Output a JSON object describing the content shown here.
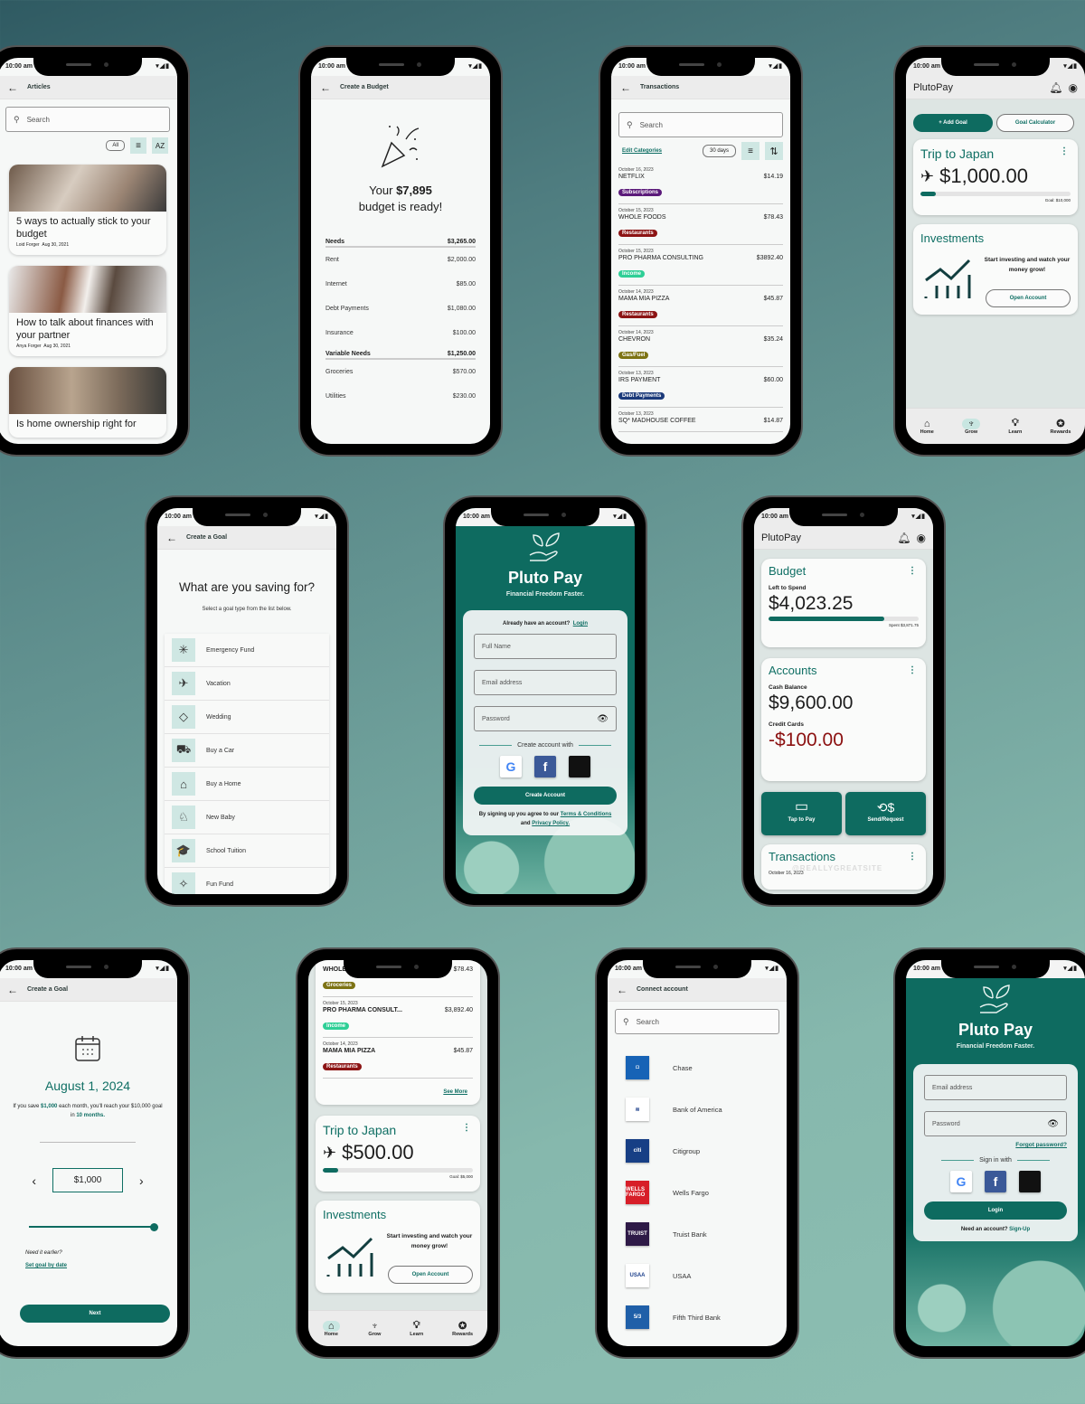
{
  "status_time": "10:00 am",
  "status_icons": "▾◢▮",
  "articles": {
    "title": "Articles",
    "search_placeholder": "Search",
    "filter_all": "All",
    "sort_label": "AZ",
    "items": [
      {
        "title": "5 ways to actually stick to your budget",
        "author": "Loid Forger",
        "date": "Aug 30, 2021"
      },
      {
        "title": "How to talk about finances with your partner",
        "author": "Anya Forger",
        "date": "Aug 30, 2021"
      },
      {
        "title": "Is home ownership right for",
        "author": "",
        "date": ""
      }
    ]
  },
  "budget_ready": {
    "title": "Create a Budget",
    "heading_prefix": "Your",
    "heading_amount": "$7,895",
    "heading_suffix": "budget is ready!",
    "sections": [
      {
        "name": "Needs",
        "total": "$3,265.00",
        "rows": [
          {
            "label": "Rent",
            "value": "$2,000.00"
          },
          {
            "label": "Internet",
            "value": "$85.00"
          },
          {
            "label": "Debt Payments",
            "value": "$1,080.00"
          },
          {
            "label": "Insurance",
            "value": "$100.00"
          }
        ]
      },
      {
        "name": "Variable Needs",
        "total": "$1,250.00",
        "rows": [
          {
            "label": "Groceries",
            "value": "$570.00"
          },
          {
            "label": "Utilities",
            "value": "$230.00"
          }
        ]
      }
    ]
  },
  "transactions": {
    "title": "Transactions",
    "search_placeholder": "Search",
    "edit_categories": "Edit Categories",
    "range": "30 days",
    "items": [
      {
        "date": "October 16, 2023",
        "name": "NETFLIX",
        "amount": "$14.19",
        "category": "Subscriptions",
        "color": "#5b1a7a"
      },
      {
        "date": "October 15, 2023",
        "name": "WHOLE FOODS",
        "amount": "$78.43",
        "category": "Restaurants",
        "color": "#8c1414"
      },
      {
        "date": "October 15, 2023",
        "name": "PRO PHARMA CONSULTING",
        "amount": "$3892.40",
        "category": "Income",
        "color": "#2ecf96"
      },
      {
        "date": "October 14, 2023",
        "name": "MAMA MIA PIZZA",
        "amount": "$45.87",
        "category": "Restaurants",
        "color": "#8c1414"
      },
      {
        "date": "October 14, 2023",
        "name": "CHEVRON",
        "amount": "$35.24",
        "category": "Gas/Fuel",
        "color": "#7d7314"
      },
      {
        "date": "October 13, 2023",
        "name": "IRS PAYMENT",
        "amount": "$60.00",
        "category": "Debt Payments",
        "color": "#1b3a7a"
      },
      {
        "date": "October 13, 2023",
        "name": "SQ* MADHOUSE COFFEE",
        "amount": "$14.87",
        "category": "",
        "color": "#8c1414"
      }
    ]
  },
  "grow": {
    "app_name": "PlutoPay",
    "add_goal": "+ Add Goal",
    "goal_calculator": "Goal Calculator",
    "goal_title": "Trip to Japan",
    "goal_amount": "$1,000.00",
    "goal_target": "Goal: $10,000",
    "goal_progress": 0.1,
    "investments_title": "Investments",
    "investments_text": "Start investing and watch your money grow!",
    "open_account": "Open Account",
    "active_tab": "Grow"
  },
  "tabs": [
    "Home",
    "Grow",
    "Learn",
    "Rewards"
  ],
  "create_goal": {
    "title": "Create a Goal",
    "heading": "What are you saving for?",
    "subheading": "Select a goal type from the list below.",
    "items": [
      {
        "label": "Emergency Fund",
        "icon": "✳"
      },
      {
        "label": "Vacation",
        "icon": "✈"
      },
      {
        "label": "Wedding",
        "icon": "◇"
      },
      {
        "label": "Buy a Car",
        "icon": "⛟"
      },
      {
        "label": "Buy a Home",
        "icon": "⌂"
      },
      {
        "label": "New Baby",
        "icon": "♘"
      },
      {
        "label": "School Tuition",
        "icon": "🎓"
      },
      {
        "label": "Fun Fund",
        "icon": "✧"
      }
    ]
  },
  "signup": {
    "brand": "Pluto Pay",
    "tagline": "Financial Freedom Faster.",
    "have_account": "Already have an account?",
    "login_link": "Login",
    "full_name_placeholder": "Full Name",
    "email_placeholder": "Email address",
    "password_placeholder": "Password",
    "create_with": "Create account with",
    "create_button": "Create Account",
    "terms_prefix": "By signing up you agree to our",
    "terms_link": "Terms & Conditions",
    "terms_and": "and",
    "privacy_link": "Privacy Policy."
  },
  "home": {
    "app_name": "PlutoPay",
    "budget_title": "Budget",
    "left_to_spend_label": "Left to Spend",
    "left_to_spend": "$4,023.25",
    "spent": "Spent $3,871.75",
    "budget_progress": 0.77,
    "accounts_title": "Accounts",
    "cash_label": "Cash Balance",
    "cash": "$9,600.00",
    "credit_label": "Credit Cards",
    "credit": "-$100.00",
    "tap_to_pay": "Tap to Pay",
    "send_request": "Send/Request",
    "transactions_title": "Transactions",
    "tx_date": "October 16, 2023",
    "watermark": "@REALLYGREATSITE"
  },
  "goal_amount": {
    "title": "Create a Goal",
    "date": "August 1, 2024",
    "text_1": "If you save",
    "amount_hl": "$1,000",
    "text_2": "each month, you'll reach your $10,000 goal in",
    "months_hl": "10 months.",
    "stepper_value": "$1,000",
    "slider_value": 1.0,
    "need_earlier": "Need it earlier?",
    "set_by_date": "Set goal by date",
    "next": "Next"
  },
  "home_scrolled": {
    "items": [
      {
        "date": "",
        "name": "WHOLE",
        "amount": "$78.43",
        "category": "Groceries",
        "color": "#7d7314"
      },
      {
        "date": "October 15, 2023",
        "name": "PRO PHARMA CONSULT...",
        "amount": "$3,892.40",
        "category": "Income",
        "color": "#2ecf96"
      },
      {
        "date": "October 14, 2023",
        "name": "MAMA MIA PIZZA",
        "amount": "$45.87",
        "category": "Restaurants",
        "color": "#8c1414"
      }
    ],
    "see_more": "See More",
    "goal_title": "Trip to Japan",
    "goal_amount": "$500.00",
    "goal_target": "Goal: $5,000",
    "goal_progress": 0.1,
    "investments_title": "Investments",
    "investments_text": "Start investing and watch your money grow!",
    "open_account": "Open Account",
    "active_tab": "Home"
  },
  "connect": {
    "title": "Connect account",
    "search_placeholder": "Search",
    "banks": [
      {
        "name": "Chase",
        "logo": "◘",
        "bg": "#1763b6"
      },
      {
        "name": "Bank of America",
        "logo": "≋",
        "bg": "#ffffff"
      },
      {
        "name": "Citigroup",
        "logo": "citi",
        "bg": "#173f85"
      },
      {
        "name": "Wells Fargo",
        "logo": "WELLS FARGO",
        "bg": "#d71e28"
      },
      {
        "name": "Truist Bank",
        "logo": "TRUIST",
        "bg": "#2e1a47"
      },
      {
        "name": "USAA",
        "logo": "USAA",
        "bg": "#ffffff"
      },
      {
        "name": "Fifth Third Bank",
        "logo": "5/3",
        "bg": "#1f5fa8"
      }
    ]
  },
  "login": {
    "brand": "Pluto Pay",
    "tagline": "Financial Freedom Faster.",
    "email_placeholder": "Email address",
    "password_placeholder": "Password",
    "forgot": "Forgot password?",
    "sign_in_with": "Sign in with",
    "login_button": "Login",
    "need_account": "Need an account?",
    "signup_link": "Sign-Up"
  },
  "colors": {
    "brand": "#0e6b60",
    "negative": "#8b1010",
    "chip_bg": "#cfe7e3"
  }
}
